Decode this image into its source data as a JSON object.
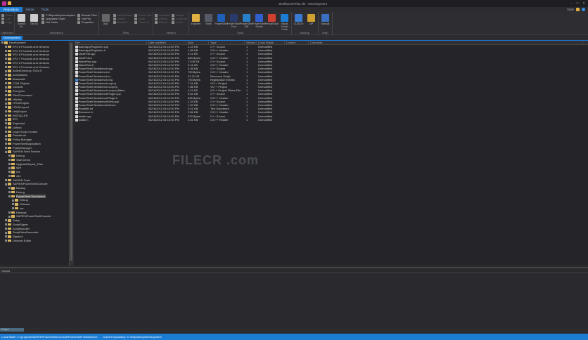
{
  "window": {
    "title": "WorkbenchPlus.sln - Development",
    "min": "–",
    "max": "□",
    "close": "✕"
  },
  "tabs": [
    {
      "label": "Repository",
      "active": true
    },
    {
      "label": "Home"
    },
    {
      "label": "Tools"
    }
  ],
  "topright": {
    "label": "Style"
  },
  "ribbon": {
    "clipboard": {
      "label": "Clipboard",
      "items": [
        "Paste",
        "Cut",
        "Copy"
      ]
    },
    "repository": {
      "label": "Repository",
      "big": [
        "Submit All",
        "Get All"
      ],
      "small": [
        "C:\\Repository\\workspace",
        "Uploaded Folder",
        "Get Folder",
        "Browse Files",
        "Get File",
        "Properties"
      ]
    },
    "files": {
      "label": "Files",
      "big": [
        "Add"
      ],
      "small": [
        "Add Solution",
        "Delete",
        "Rename",
        "Check Out",
        "Undo",
        "Check In"
      ]
    },
    "version": {
      "label": "Version",
      "small": [
        "Annotate",
        "History",
        "Branch",
        "Merge",
        "Compare",
        "Label"
      ]
    },
    "tools": {
      "label": "Tools",
      "big": [
        "Explorer",
        "Shell",
        "PowerShell",
        "PowerShell Core",
        "PowerShell ISE",
        "PowerShell Studio",
        "PrimalScript",
        "Visual Studio Code"
      ]
    },
    "backup": {
      "label": "Backup",
      "big": [
        "CD/DVD",
        "ZIP"
      ]
    },
    "help": {
      "label": "Help",
      "big": [
        "Manual"
      ]
    }
  },
  "doc_tab": "Development",
  "tree": [
    {
      "l": "Development",
      "d": 0
    },
    {
      "l": "EFX 8 Products and versions",
      "d": 1
    },
    {
      "l": "EFX 8 Products and versions",
      "d": 1
    },
    {
      "l": "EFX 8 Products and versions",
      "d": 1
    },
    {
      "l": "EFX 7 Products and versions",
      "d": 1
    },
    {
      "l": "EFX 8 Products and versions",
      "d": 1
    },
    {
      "l": "EFX 9 Products and Versions",
      "d": 1
    },
    {
      "l": "ActiveDirectory TOOLS",
      "d": 1
    },
    {
      "l": "Annotations",
      "d": 1
    },
    {
      "l": "Beanstalk",
      "d": 1
    },
    {
      "l": "COM Objects",
      "d": 1
    },
    {
      "l": "Console",
      "d": 1
    },
    {
      "l": "Encryptor",
      "d": 1
    },
    {
      "l": "FileSCommand",
      "d": 1
    },
    {
      "l": "HWInfo",
      "d": 1
    },
    {
      "l": "HTMLEngine",
      "d": 1
    },
    {
      "l": "HTMLLayout",
      "d": 1
    },
    {
      "l": "HelpExport",
      "d": 1
    },
    {
      "l": "INSTALLER",
      "d": 1
    },
    {
      "l": "IPO",
      "d": 1
    },
    {
      "l": "Keyboard",
      "d": 1
    },
    {
      "l": "Listbox",
      "d": 1
    },
    {
      "l": "Login Script Creator",
      "d": 1
    },
    {
      "l": "PacketLab",
      "d": 1
    },
    {
      "l": "Policy Manager",
      "d": 1
    },
    {
      "l": "PowerShellApplication",
      "d": 1
    },
    {
      "l": "ProfileManager",
      "d": 1
    },
    {
      "l": "SAPIEN Shell Service",
      "d": 1
    },
    {
      "l": "Debug",
      "d": 2
    },
    {
      "l": "Start Demo",
      "d": 2
    },
    {
      "l": "UpgradeReport_Files",
      "d": 2
    },
    {
      "l": "ipch",
      "d": 2
    },
    {
      "l": "res",
      "d": 2
    },
    {
      "l": "x64",
      "d": 2
    },
    {
      "l": "SAPIEN Tools",
      "d": 1
    },
    {
      "l": "SAPIENPowerShellConsole",
      "d": 1
    },
    {
      "l": "Backup",
      "d": 2
    },
    {
      "l": "Debug",
      "d": 2
    },
    {
      "l": "PowerShell Workbench",
      "d": 2,
      "sel": true
    },
    {
      "l": "Debug",
      "d": 3
    },
    {
      "l": "Release",
      "d": 3
    },
    {
      "l": "res",
      "d": 3
    },
    {
      "l": "Release",
      "d": 2
    },
    {
      "l": "SAPIENPowerShellConsole",
      "d": 2
    },
    {
      "l": "Setup",
      "d": 1
    },
    {
      "l": "ScriptSigner",
      "d": 1
    },
    {
      "l": "ScriptBundler",
      "d": 1
    },
    {
      "l": "ScriptDataGenerator",
      "d": 1
    },
    {
      "l": "Signtool",
      "d": 1
    },
    {
      "l": "Unicode Editor",
      "d": 1
    }
  ],
  "columns": [
    "File",
    "Date modified",
    "Size",
    "Type",
    "Version",
    "Local Status",
    "Locked",
    "Comment"
  ],
  "files": [
    [
      "BatchAppPluginInfo.cpp",
      "05/16/2012 04:10:50 PM",
      "2.43 KB",
      "C++ Source",
      "1",
      "Unmodified"
    ],
    [
      "BatchAppPluginInfo.h",
      "05/16/2012 04:10:50 PM",
      "1.08 KB",
      "C/C++ Header",
      "1",
      "Unmodified"
    ],
    [
      "ClickFirst.cpp",
      "05/16/2012 04:10:50 PM",
      "3.11 KB",
      "C++ Source",
      "1",
      "Unmodified"
    ],
    [
      "ClickFirst.h",
      "05/16/2012 04:10:50 PM",
      "505 Bytes",
      "C/C++ Header",
      "1",
      "Unmodified"
    ],
    [
      "WaterFirst.cpp",
      "05/16/2012 04:10:50 PM",
      "17.00 KB",
      "C++ Source",
      "1",
      "Unmodified"
    ],
    [
      "WaterFirst.h",
      "05/16/2012 04:10:50 PM",
      "3.11 KB",
      "C/C++ Header",
      "1",
      "Unmodified"
    ],
    [
      "PowerShell Workbench.cpp",
      "05/16/2012 04:10:50 PM",
      "5.26 KB",
      "C++ Source",
      "1",
      "Unmodified"
    ],
    [
      "PowerShell Workbench.h",
      "05/16/2012 04:10:50 PM",
      "753 Bytes",
      "C/C++ Header",
      "1",
      "Unmodified"
    ],
    [
      "PowerShell Workbench.rc",
      "05/16/2012 04:10:50 PM",
      "21.71 KB",
      "Resource Script",
      "1",
      "Unmodified"
    ],
    [
      "PowerShell Workbench.reg",
      "05/16/2012 04:10:50 PM",
      "793 Bytes",
      "Registration Entries",
      "1",
      "Unmodified"
    ],
    [
      "PowerShell Workbench.vcproj",
      "05/16/2012 04:10:50 PM",
      "7.21 KB",
      "VC++ Project",
      "1",
      "Unmodified"
    ],
    [
      "PowerShell Workbench.vcxproj",
      "05/16/2012 04:10:50 PM",
      "7.86 KB",
      "VC++ Project",
      "1",
      "Unmodified"
    ],
    [
      "PowerShell Workbench.vcxproj.filters",
      "05/16/2012 04:10:50 PM",
      "4.11 KB",
      "VC++ Project Filters File",
      "1",
      "Unmodified"
    ],
    [
      "PowerShell WorkbenchPlugin.cpp",
      "05/16/2012 04:10:50 PM",
      "5.02 KB",
      "C++ Source",
      "1",
      "Unmodified"
    ],
    [
      "PowerShell WorkbenchPlugin.h",
      "05/16/2012 04:10:50 PM",
      "696 Bytes",
      "C/C++ Header",
      "1",
      "Unmodified"
    ],
    [
      "PowerShell WorkbenchView.cpp",
      "05/16/2012 04:10:50 PM",
      "2.29 KB",
      "C++ Source",
      "1",
      "Unmodified"
    ],
    [
      "PowerShell WorkbenchView.h",
      "05/16/2012 04:10:50 PM",
      "1.20 KB",
      "C/C++ Header",
      "1",
      "Unmodified"
    ],
    [
      "ReadMe.txt",
      "05/16/2012 04:10:50 PM",
      "0.41 KB",
      "Text Document",
      "1",
      "Unmodified"
    ],
    [
      "Resource.h",
      "05/16/2012 04:10:50 PM",
      "2.56 KB",
      "C/C++ Header",
      "1",
      "Unmodified"
    ],
    [
      "stdafx.cpp",
      "05/16/2012 04:10:50 PM",
      "222 Bytes",
      "C++ Source",
      "1",
      "Unmodified"
    ],
    [
      "stdafx.h",
      "05/16/2012 04:10:50 PM",
      "2.61 KB",
      "C/C++ Header",
      "1",
      "Unmodified"
    ]
  ],
  "watermark": "FILECR .com",
  "output": {
    "title": "Output",
    "tab": "Output"
  },
  "status": {
    "local": "Local folder: C:\\projects\\SAPIEN\\PowerShellConsole\\PowerShell Workbench",
    "repo": "Current repository: C:\\Repository\\Development"
  },
  "colors": {
    "accent": "#1c7cd4",
    "folder": "#d9b560"
  }
}
